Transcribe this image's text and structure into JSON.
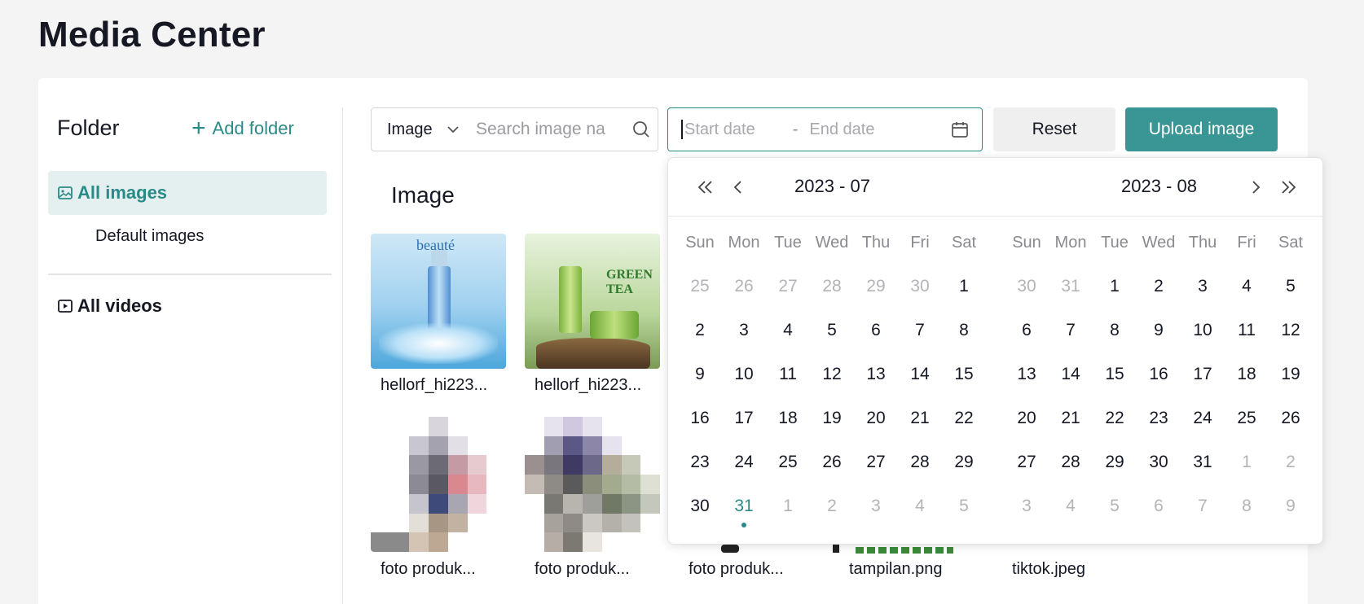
{
  "page": {
    "title": "Media Center"
  },
  "sidebar": {
    "title": "Folder",
    "add_folder_label": "Add folder",
    "items": [
      {
        "label": "All images",
        "icon": "image-icon",
        "active": true
      },
      {
        "label": "Default images"
      },
      {
        "label": "All videos",
        "icon": "video-icon"
      }
    ]
  },
  "toolbar": {
    "type_select": "Image",
    "search_placeholder": "Search image na",
    "date_start_placeholder": "Start date",
    "date_separator": "-",
    "date_end_placeholder": "End date",
    "reset_label": "Reset",
    "upload_label": "Upload image"
  },
  "section": {
    "title": "Image"
  },
  "images": [
    {
      "name": "hellorf_hi223..."
    },
    {
      "name": "hellorf_hi223..."
    },
    {
      "name": "foto produk..."
    },
    {
      "name": "foto produk..."
    },
    {
      "name": "foto produk..."
    },
    {
      "name": "tampilan.png"
    },
    {
      "name": "tiktok.jpeg"
    }
  ],
  "thumb_texts": {
    "t1_brand": "beauté",
    "t2_brand": "GREEN TEA"
  },
  "calendar": {
    "weekdays": [
      "Sun",
      "Mon",
      "Tue",
      "Wed",
      "Thu",
      "Fri",
      "Sat"
    ],
    "months": [
      {
        "label": "2023 - 07",
        "weeks": [
          [
            "25",
            "26",
            "27",
            "28",
            "29",
            "30",
            "1"
          ],
          [
            "2",
            "3",
            "4",
            "5",
            "6",
            "7",
            "8"
          ],
          [
            "9",
            "10",
            "11",
            "12",
            "13",
            "14",
            "15"
          ],
          [
            "16",
            "17",
            "18",
            "19",
            "20",
            "21",
            "22"
          ],
          [
            "23",
            "24",
            "25",
            "26",
            "27",
            "28",
            "29"
          ],
          [
            "30",
            "31",
            "1",
            "2",
            "3",
            "4",
            "5"
          ]
        ],
        "muted": [
          [
            0,
            0
          ],
          [
            0,
            1
          ],
          [
            0,
            2
          ],
          [
            0,
            3
          ],
          [
            0,
            4
          ],
          [
            0,
            5
          ],
          [
            5,
            2
          ],
          [
            5,
            3
          ],
          [
            5,
            4
          ],
          [
            5,
            5
          ],
          [
            5,
            6
          ]
        ],
        "today": [
          5,
          1
        ]
      },
      {
        "label": "2023 - 08",
        "weeks": [
          [
            "30",
            "31",
            "1",
            "2",
            "3",
            "4",
            "5"
          ],
          [
            "6",
            "7",
            "8",
            "9",
            "10",
            "11",
            "12"
          ],
          [
            "13",
            "14",
            "15",
            "16",
            "17",
            "18",
            "19"
          ],
          [
            "20",
            "21",
            "22",
            "23",
            "24",
            "25",
            "26"
          ],
          [
            "27",
            "28",
            "29",
            "30",
            "31",
            "1",
            "2"
          ],
          [
            "3",
            "4",
            "5",
            "6",
            "7",
            "8",
            "9"
          ]
        ],
        "muted": [
          [
            0,
            0
          ],
          [
            0,
            1
          ],
          [
            4,
            5
          ],
          [
            4,
            6
          ],
          [
            5,
            0
          ],
          [
            5,
            1
          ],
          [
            5,
            2
          ],
          [
            5,
            3
          ],
          [
            5,
            4
          ],
          [
            5,
            5
          ],
          [
            5,
            6
          ]
        ],
        "today": null
      }
    ]
  },
  "colors": {
    "accent": "#2a8a88",
    "accent_bg": "#e3f0ef",
    "upload_bg": "#3a9694"
  }
}
